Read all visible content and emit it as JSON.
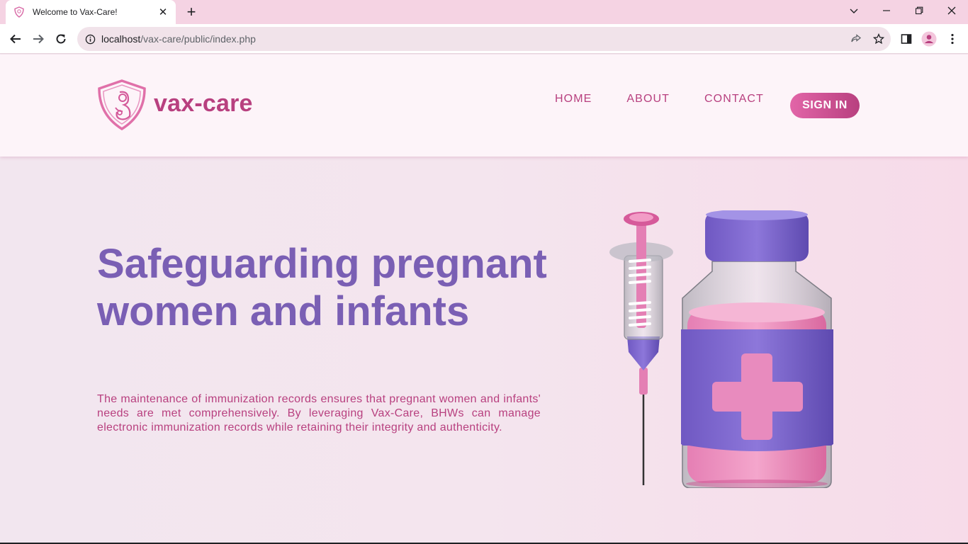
{
  "browser": {
    "tab_title": "Welcome to Vax-Care!",
    "url_host": "localhost",
    "url_path": "/vax-care/public/index.php",
    "icons": [
      "back-icon",
      "forward-icon",
      "reload-icon",
      "info-icon",
      "share-icon",
      "star-icon",
      "sidebar-icon",
      "profile-icon",
      "menu-icon"
    ]
  },
  "header": {
    "brand": "vax-care",
    "nav": [
      {
        "label": "HOME"
      },
      {
        "label": "ABOUT"
      },
      {
        "label": "CONTACT"
      }
    ],
    "signin_label": "SIGN IN"
  },
  "hero": {
    "title": "Safeguarding pregnant women and infants",
    "text": "The maintenance of immunization records ensures that pregnant women and infants' needs are met comprehensively. By leveraging Vax-Care, BHWs can manage electronic immunization records while retaining their integrity and authenticity."
  },
  "colors": {
    "brand_pink": "#b8407f",
    "brand_purple": "#7a5fb4",
    "tabstrip": "#f5d3e3"
  }
}
